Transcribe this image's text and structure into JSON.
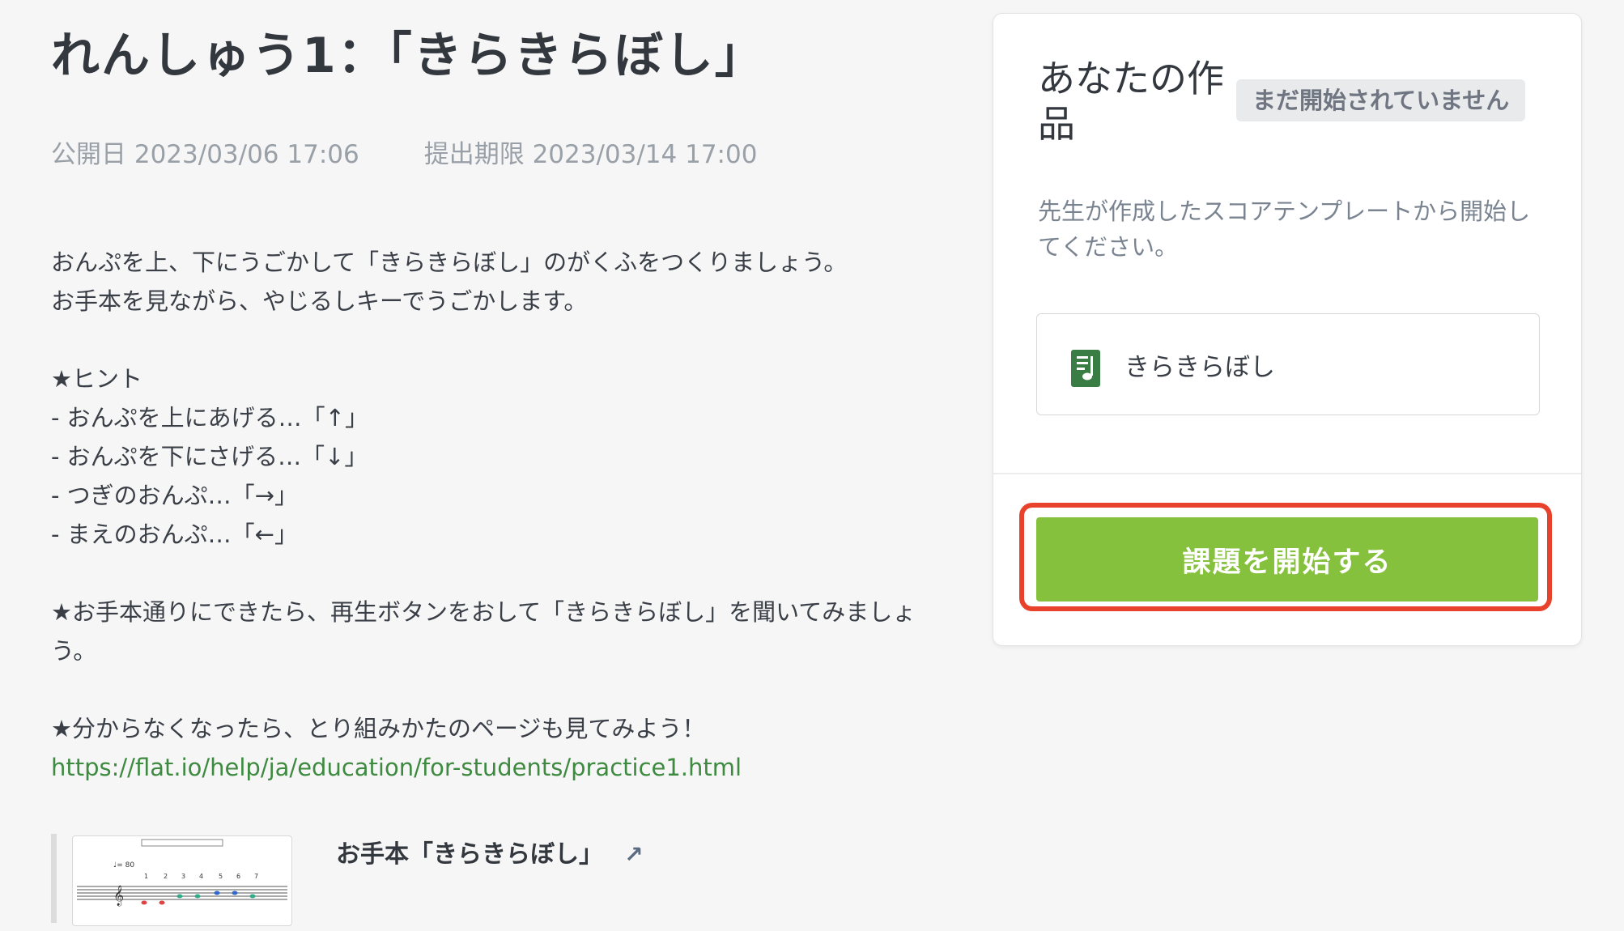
{
  "assignment": {
    "title": "れんしゅう1：「きらきらぼし」",
    "published": "公開日 2023/03/06 17:06",
    "deadline": "提出期限 2023/03/14 17:00",
    "description": {
      "line1": "おんぷを上、下にうごかして「きらきらぼし」のがくふをつくりましょう。",
      "line2": "お手本を見ながら、やじるしキーでうごかします。",
      "hint_title": "★ヒント",
      "hint1": "- おんぷを上にあげる…「↑」",
      "hint2": "- おんぷを下にさげる…「↓」",
      "hint3": "- つぎのおんぷ…「→」",
      "hint4": "- まえのおんぷ…「←」",
      "play_note": "★お手本通りにできたら、再生ボタンをおして「きらきらぼし」を聞いてみましょう。",
      "help_note": "★分からなくなったら、とり組みかたのページも見てみよう！",
      "help_link": "https://flat.io/help/ja/education/for-students/practice1.html"
    },
    "reference": {
      "title": "お手本「きらきらぼし」",
      "external_icon": "external-link-icon",
      "thumbnail_tempo": "♩= 80"
    }
  },
  "work_panel": {
    "heading": "あなたの作品",
    "status_badge": "まだ開始されていません",
    "instructions": "先生が作成したスコアテンプレートから開始してください。",
    "template_name": "きらきらぼし",
    "template_icon": "music-score-icon",
    "start_button": "課題を開始する"
  },
  "colors": {
    "accent_green": "#86c13d",
    "link_green": "#3d8a40",
    "highlight_red": "#e8412c",
    "badge_bg": "#e9eaec"
  }
}
